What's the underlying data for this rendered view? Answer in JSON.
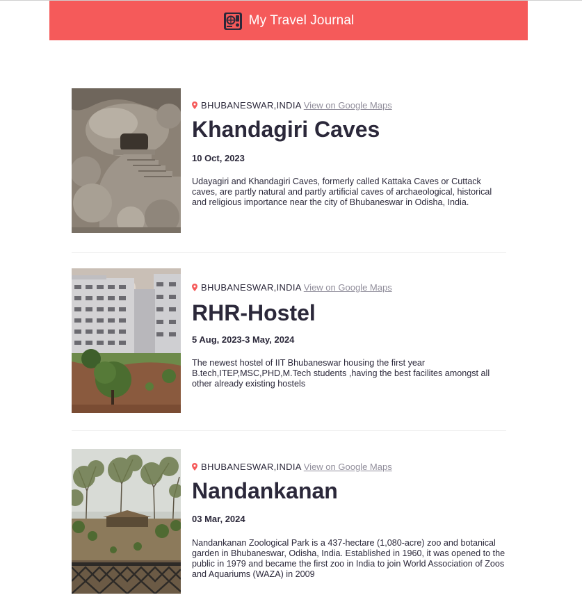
{
  "header": {
    "title": "My Travel Journal",
    "logo_icon": "globe-icon",
    "background": "#F55A5A"
  },
  "entries": [
    {
      "location": "BHUBANESWAR,INDIA",
      "map_link": "View on Google Maps",
      "title": "Khandagiri Caves",
      "date": "10 Oct, 2023",
      "description": "Udayagiri and Khandagiri Caves, formerly called Kattaka Caves or Cuttack caves, are partly natural and partly artificial caves of archaeological, historical and religious importance near the city of Bhubaneswar in Odisha, India.",
      "photo_icon": "cave-photo"
    },
    {
      "location": "BHUBANESWAR,INDIA",
      "map_link": "View on Google Maps",
      "title": "RHR-Hostel",
      "date": "5 Aug, 2023-3 May, 2024",
      "description": "The newest hostel of IIT Bhubaneswar housing the first year B.tech,ITEP,MSC,PHD,M.Tech students ,having the best facilites amongst all other already existing hostels",
      "photo_icon": "hostel-photo"
    },
    {
      "location": "BHUBANESWAR,INDIA",
      "map_link": "View on Google Maps",
      "title": "Nandankanan",
      "date": "03 Mar, 2024",
      "description": "Nandankanan Zoological Park is a 437-hectare (1,080-acre) zoo and botanical garden in Bhubaneswar, Odisha, India. Established in 1960, it was opened to the public in 1979 and became the first zoo in India to join World Association of Zoos and Aquariums (WAZA) in 2009",
      "photo_icon": "zoo-photo"
    }
  ],
  "accent_pin_color": "#F55A5A",
  "link_color": "#918E9B",
  "text_color": "#2B283A"
}
